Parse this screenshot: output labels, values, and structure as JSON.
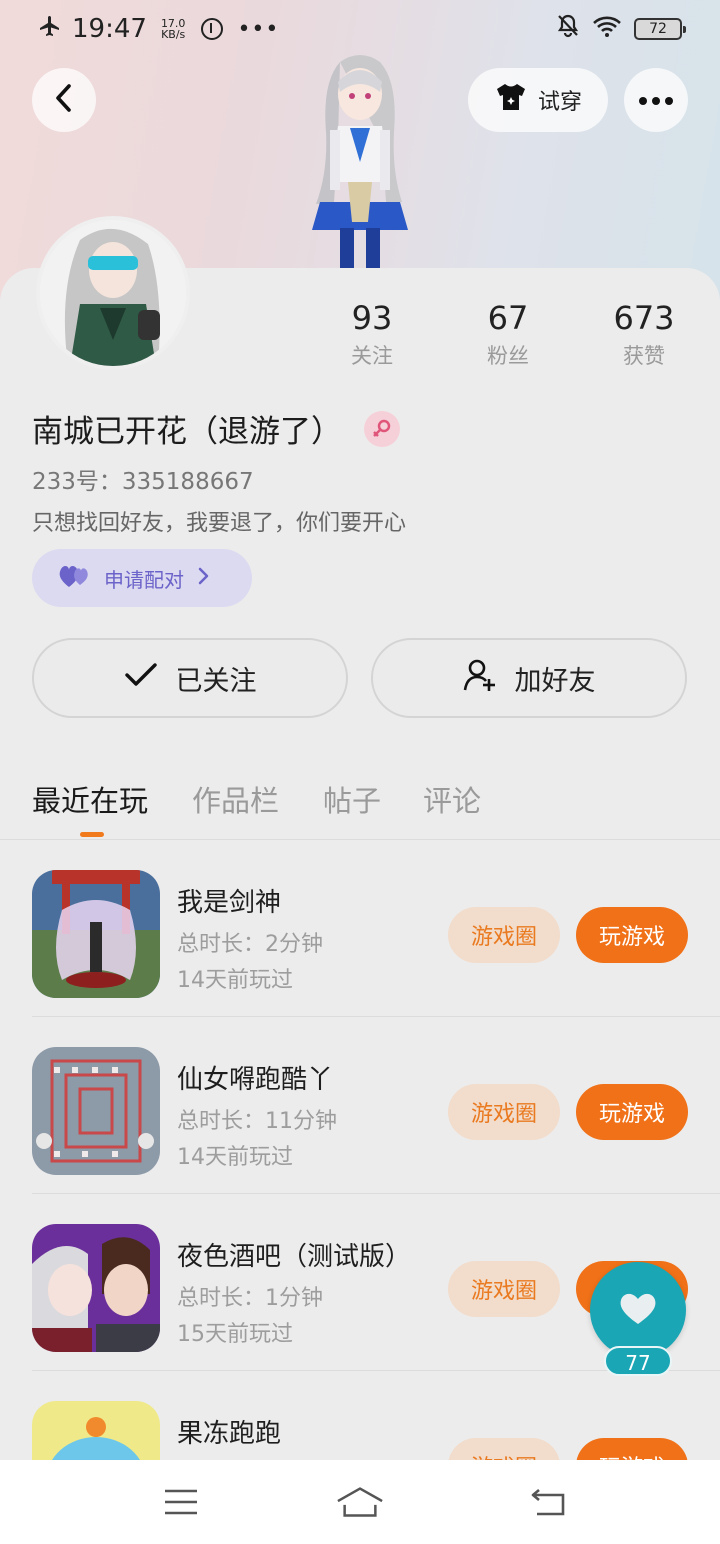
{
  "status_bar": {
    "time": "19:47",
    "net_speed_value": "17.0",
    "net_speed_unit": "KB/s",
    "more_icon": "•••",
    "battery": "72"
  },
  "header": {
    "try_on_label": "试穿"
  },
  "profile": {
    "stats": [
      {
        "value": "93",
        "label": "关注"
      },
      {
        "value": "67",
        "label": "粉丝"
      },
      {
        "value": "673",
        "label": "获赞"
      }
    ],
    "name": "南城已开花（退游了）",
    "uid": "233号：335188667",
    "bio": "只想找回好友，我要退了，你们要开心",
    "pair_label": "申请配对"
  },
  "actions": {
    "followed_label": "已关注",
    "add_friend_label": "加好友"
  },
  "tabs": [
    {
      "label": "最近在玩"
    },
    {
      "label": "作品栏"
    },
    {
      "label": "帖子"
    },
    {
      "label": "评论"
    }
  ],
  "games": [
    {
      "title": "我是剑神",
      "duration": "总时长：2分钟",
      "last_played": "14天前玩过",
      "circle_label": "游戏圈",
      "play_label": "玩游戏"
    },
    {
      "title": "仙女嘚跑酷丫",
      "duration": "总时长：11分钟",
      "last_played": "14天前玩过",
      "circle_label": "游戏圈",
      "play_label": "玩游戏"
    },
    {
      "title": "夜色酒吧（测试版）",
      "duration": "总时长：1分钟",
      "last_played": "15天前玩过",
      "circle_label": "游戏圈",
      "play_label": "玩游戏"
    },
    {
      "title": "果冻跑跑",
      "circle_label": "游戏圈",
      "play_label": "玩游戏"
    }
  ],
  "floating_like": {
    "count": "77"
  },
  "colors": {
    "accent_orange": "#f07118",
    "pair_purple": "#6b63c9",
    "like_teal": "#1aa6b5"
  }
}
